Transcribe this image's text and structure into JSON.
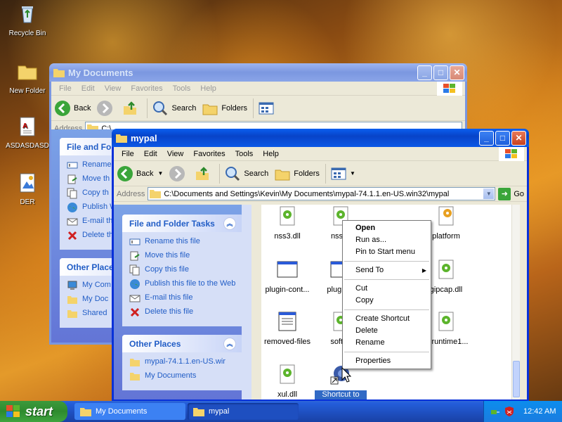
{
  "desktop": {
    "icons": [
      {
        "label": "Recycle Bin",
        "icon": "recycle-bin-icon"
      },
      {
        "label": "New Folder",
        "icon": "folder-icon"
      },
      {
        "label": "ASDASDASD",
        "icon": "document-icon"
      },
      {
        "label": "DER",
        "icon": "image-file-icon"
      }
    ]
  },
  "back_window": {
    "title": "My Documents",
    "menu": [
      "File",
      "Edit",
      "View",
      "Favorites",
      "Tools",
      "Help"
    ],
    "toolbar": {
      "back": "Back",
      "search": "Search",
      "folders": "Folders"
    },
    "address_label": "Address",
    "address_value": "C:\\",
    "tasks_title": "File and Fo",
    "tasks": [
      "Rename",
      "Move th",
      "Copy th",
      "Publish Web",
      "E-mail th",
      "Delete th"
    ],
    "other_title": "Other Place",
    "other": [
      "My Com",
      "My Doc",
      "Shared"
    ]
  },
  "front_window": {
    "title": "mypal",
    "menu": [
      "File",
      "Edit",
      "View",
      "Favorites",
      "Tools",
      "Help"
    ],
    "toolbar": {
      "back": "Back",
      "search": "Search",
      "folders": "Folders"
    },
    "address_label": "Address",
    "address_value": "C:\\Documents and Settings\\Kevin\\My Documents\\mypal-74.1.1.en-US.win32\\mypal",
    "go_label": "Go",
    "tasks_title": "File and Folder Tasks",
    "tasks": [
      {
        "label": "Rename this file",
        "icon": "rename-icon"
      },
      {
        "label": "Move this file",
        "icon": "move-icon"
      },
      {
        "label": "Copy this file",
        "icon": "copy-icon"
      },
      {
        "label": "Publish this file to the Web",
        "icon": "globe-icon"
      },
      {
        "label": "E-mail this file",
        "icon": "email-icon"
      },
      {
        "label": "Delete this file",
        "icon": "delete-icon"
      }
    ],
    "other_title": "Other Places",
    "other": [
      {
        "label": "mypal-74.1.1.en-US.wir",
        "icon": "folder-icon"
      },
      {
        "label": "My Documents",
        "icon": "folder-icon"
      }
    ],
    "files": [
      {
        "label": "nss3.dll",
        "icon": "dll-icon"
      },
      {
        "label": "nssck",
        "icon": "dll-icon"
      },
      {
        "label": "plugin-cont...",
        "icon": "app-window-icon"
      },
      {
        "label": "plugin-h",
        "icon": "app-window-icon"
      },
      {
        "label": "removed-files",
        "icon": "text-file-icon"
      },
      {
        "label": "softok",
        "icon": "dll-icon"
      },
      {
        "label": "xul.dll",
        "icon": "dll-icon"
      },
      {
        "label": "Shortcut to mypal",
        "icon": "mypal-shortcut-icon"
      },
      {
        "label": "platform",
        "icon": "gear-icon"
      },
      {
        "label": "gipcap.dll",
        "icon": "dll-icon"
      },
      {
        "label": "vcruntime1...",
        "icon": "dll-icon"
      }
    ]
  },
  "context_menu": {
    "items": [
      "Open",
      "Run as...",
      "Pin to Start menu",
      "Send To",
      "Cut",
      "Copy",
      "Create Shortcut",
      "Delete",
      "Rename",
      "Properties"
    ]
  },
  "taskbar": {
    "start": "start",
    "buttons": [
      "My Documents",
      "mypal"
    ],
    "clock": "12:42 AM"
  }
}
